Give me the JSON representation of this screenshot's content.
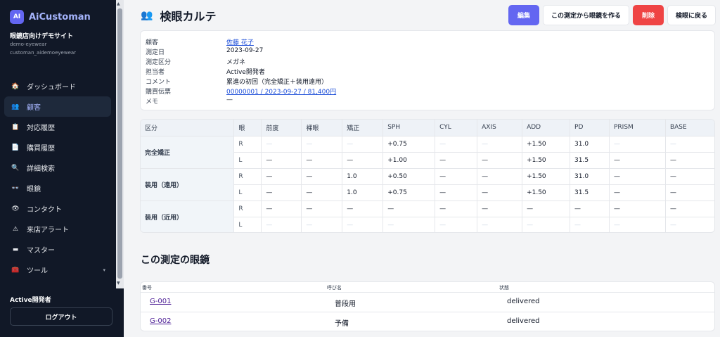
{
  "app": {
    "logo_text": "AI",
    "name": "AiCustoman"
  },
  "tenant": {
    "name": "眼鏡店向けデモサイト",
    "code": "demo-eyewear",
    "db": "customan_aidemoeyewear"
  },
  "nav": [
    {
      "label": "ダッシュボード",
      "icon": "🏠",
      "icon_name": "home-icon",
      "active": false
    },
    {
      "label": "顧客",
      "icon": "👥",
      "icon_name": "customers-icon",
      "active": true
    },
    {
      "label": "対応履歴",
      "icon": "📋",
      "icon_name": "history-icon",
      "active": false
    },
    {
      "label": "購買履歴",
      "icon": "📄",
      "icon_name": "receipt-icon",
      "active": false
    },
    {
      "label": "詳細検索",
      "icon": "🔍",
      "icon_name": "search-icon",
      "active": false
    },
    {
      "label": "眼鏡",
      "icon": "👓",
      "icon_name": "glasses-icon",
      "active": false
    },
    {
      "label": "コンタクト",
      "icon": "👁",
      "icon_name": "eye-icon",
      "active": false
    },
    {
      "label": "来店アラート",
      "icon": "⚠",
      "icon_name": "alert-icon",
      "active": false
    },
    {
      "label": "マスター",
      "icon": "▬",
      "icon_name": "master-icon",
      "active": false
    },
    {
      "label": "ツール",
      "icon": "🧰",
      "icon_name": "toolbox-icon",
      "active": false,
      "caret": "▾"
    }
  ],
  "user": {
    "name": "Active開発者",
    "logout_label": "ログアウト"
  },
  "page": {
    "icon": "👥",
    "title": "検眼カルテ"
  },
  "actions": {
    "edit": "編集",
    "create_glasses": "この測定から眼鏡を作る",
    "delete": "削除",
    "back": "検眼に戻る"
  },
  "info": [
    {
      "label": "顧客",
      "value": "佐藤 花子",
      "link": true
    },
    {
      "label": "測定日",
      "value": "2023-09-27",
      "link": false
    },
    {
      "label": "測定区分",
      "value": "メガネ",
      "link": false
    },
    {
      "label": "担当者",
      "value": "Active開発者",
      "link": false
    },
    {
      "label": "コメント",
      "value": "累進の初回（完全矯正＋装用遠用）",
      "link": false
    },
    {
      "label": "購買伝票",
      "value": "00000001 / 2023-09-27 / 81,400円",
      "link": true
    },
    {
      "label": "メモ",
      "value": "—",
      "link": false
    }
  ],
  "rx": {
    "headers": [
      "区分",
      "眼",
      "前度",
      "裸眼",
      "矯正",
      "SPH",
      "CYL",
      "AXIS",
      "ADD",
      "PD",
      "PRISM",
      "BASE"
    ],
    "groups": [
      {
        "name": "完全矯正",
        "rows": [
          {
            "eye": "R",
            "cells": [
              "—",
              "—",
              "—",
              "+0.75",
              "—",
              "—",
              "+1.50",
              "31.0",
              "—",
              "—"
            ],
            "muted": [
              true,
              true,
              true,
              false,
              true,
              true,
              false,
              false,
              true,
              true
            ]
          },
          {
            "eye": "L",
            "cells": [
              "—",
              "—",
              "—",
              "+1.00",
              "—",
              "—",
              "+1.50",
              "31.5",
              "—",
              "—"
            ],
            "muted": [
              false,
              false,
              false,
              false,
              false,
              false,
              false,
              false,
              false,
              false
            ]
          }
        ]
      },
      {
        "name": "装用（遠用）",
        "rows": [
          {
            "eye": "R",
            "cells": [
              "—",
              "—",
              "1.0",
              "+0.50",
              "—",
              "—",
              "+1.50",
              "31.0",
              "—",
              "—"
            ],
            "muted": [
              false,
              false,
              false,
              false,
              false,
              false,
              false,
              false,
              false,
              false
            ]
          },
          {
            "eye": "L",
            "cells": [
              "—",
              "—",
              "1.0",
              "+0.75",
              "—",
              "—",
              "+1.50",
              "31.5",
              "—",
              "—"
            ],
            "muted": [
              false,
              false,
              false,
              false,
              false,
              false,
              false,
              false,
              false,
              false
            ]
          }
        ]
      },
      {
        "name": "装用（近用）",
        "rows": [
          {
            "eye": "R",
            "cells": [
              "—",
              "—",
              "—",
              "—",
              "—",
              "—",
              "—",
              "—",
              "—",
              "—"
            ],
            "muted": [
              false,
              false,
              false,
              false,
              false,
              false,
              false,
              false,
              false,
              false
            ]
          },
          {
            "eye": "L",
            "cells": [
              "—",
              "—",
              "—",
              "—",
              "—",
              "—",
              "—",
              "—",
              "—",
              "—"
            ],
            "muted": [
              true,
              true,
              true,
              true,
              true,
              true,
              true,
              true,
              true,
              true
            ]
          }
        ]
      }
    ]
  },
  "glasses_section": {
    "title": "この測定の眼鏡",
    "headers": [
      "番号",
      "呼び名",
      "状態"
    ],
    "rows": [
      {
        "number": "G-001",
        "name": "普段用",
        "status": "delivered"
      },
      {
        "number": "G-002",
        "name": "予備",
        "status": "delivered"
      }
    ]
  },
  "colors": {
    "sidebar_bg": "#111827",
    "accent": "#6366f1",
    "danger": "#ef4444",
    "link": "#1d4ed8"
  }
}
